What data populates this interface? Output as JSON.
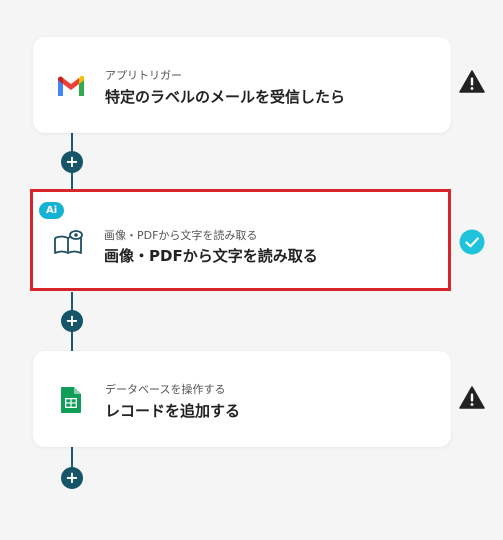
{
  "flow": {
    "steps": [
      {
        "subtitle": "アプリトリガー",
        "title": "特定のラベルのメールを受信したら",
        "icon": "gmail-icon",
        "status": "warning"
      },
      {
        "subtitle": "画像・PDFから文字を読み取る",
        "title": "画像・PDFから文字を読み取る",
        "icon": "ocr-book-eye-icon",
        "badge": "Ai",
        "status": "success"
      },
      {
        "subtitle": "データベースを操作する",
        "title": "レコードを追加する",
        "icon": "google-sheets-icon",
        "status": "warning"
      }
    ],
    "add_label": "+"
  },
  "colors": {
    "background": "#f5f5f5",
    "connector": "#1e5a6e",
    "add_button": "#165468",
    "selected_border": "#d6262b",
    "ai_badge": "#16b2d4",
    "success": "#1fc3dc",
    "warning": "#222222",
    "sheets_green": "#0f9d58"
  }
}
